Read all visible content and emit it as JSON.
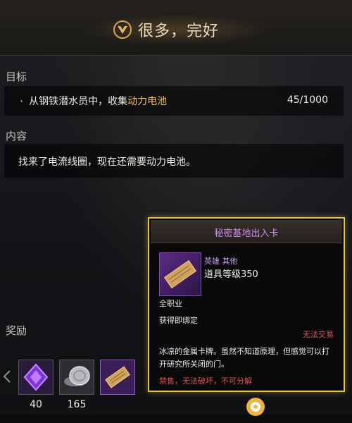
{
  "header": {
    "title": "很多，完好"
  },
  "objective": {
    "label": "目标",
    "bullet": "·",
    "text_prefix": "从钢铁潜水员中，收集",
    "text_highlight": "动力电池",
    "progress": "45/1000"
  },
  "content": {
    "label": "内容",
    "text": "找来了电流线圈，现在还需要动力电池。"
  },
  "rewards": {
    "label": "奖励",
    "items": [
      {
        "icon": "purple-crystal-icon",
        "count": "40"
      },
      {
        "icon": "silver-coin-icon",
        "count": "165"
      },
      {
        "icon": "keycard-icon",
        "count": ""
      }
    ]
  },
  "tooltip": {
    "title": "秘密基地出入卡",
    "category": "英雄 其他",
    "item_level": "道具等级350",
    "class": "全职业",
    "bind": "获得即绑定",
    "trade": "无法交易",
    "description": "冰凉的金属卡牌。虽然不知道原理，但感觉可以打开研究所关闭的门。",
    "restrictions": "禁售，无法破坏，不可分解"
  },
  "colors": {
    "accent_gold": "#e6c23e",
    "highlight": "#f3c04d",
    "rare_purple": "#d38cf0",
    "warning_red": "#e05353"
  }
}
